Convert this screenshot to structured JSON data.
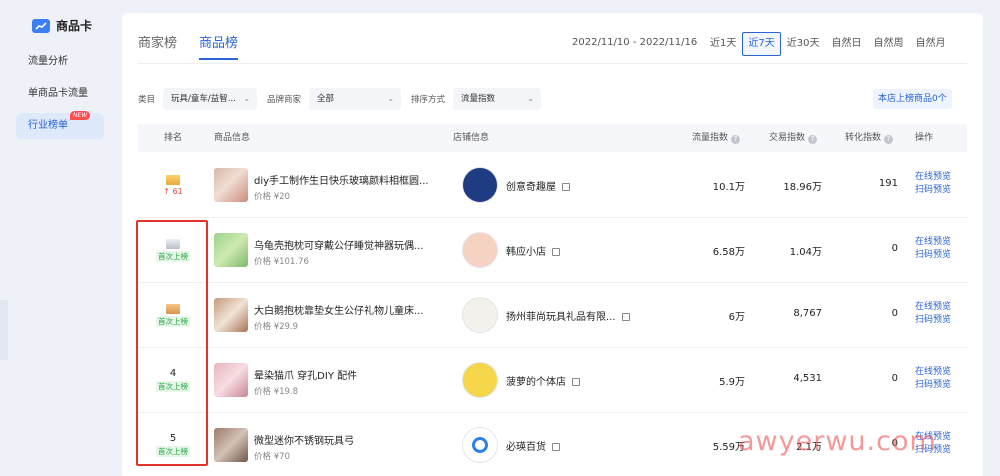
{
  "sidebar": {
    "brand": "商品卡",
    "items": [
      {
        "label": "流量分析"
      },
      {
        "label": "单商品卡流量"
      },
      {
        "label": "行业榜单",
        "badge": "NEW",
        "active": true
      }
    ]
  },
  "tabs": [
    {
      "label": "商家榜",
      "active": false
    },
    {
      "label": "商品榜",
      "active": true
    }
  ],
  "date_range": "2022/11/10 - 2022/11/16",
  "periods": [
    {
      "label": "近1天"
    },
    {
      "label": "近7天",
      "active": true
    },
    {
      "label": "近30天"
    },
    {
      "label": "自然日"
    },
    {
      "label": "自然周"
    },
    {
      "label": "自然月"
    }
  ],
  "filters": {
    "category_label": "类目",
    "category_value": "玩具/童车/益智...",
    "brand_label": "品牌商家",
    "brand_value": "全部",
    "sort_label": "排序方式",
    "sort_value": "流量指数"
  },
  "rank_count_button": "本店上榜商品0个",
  "table": {
    "headers": {
      "rank": "排名",
      "product": "商品信息",
      "shop": "店铺信息",
      "flow": "流量指数",
      "deal": "交易指数",
      "conversion": "转化指数",
      "action": "操作"
    },
    "rows": [
      {
        "crown": "gold",
        "rank": "",
        "change": "↑ 61",
        "badge": "",
        "name": "diy手工制作生日快乐玻璃颜料相框圆...",
        "price": "价格 ¥20",
        "shop": "创意奇趣屋",
        "flow": "10.1万",
        "deal": "18.96万",
        "conversion": "191"
      },
      {
        "crown": "silver",
        "rank": "",
        "change": "",
        "badge": "首次上榜",
        "name": "乌龟壳抱枕可穿戴公仔睡觉神器玩偶...",
        "price": "价格 ¥101.76",
        "shop": "韩应小店",
        "flow": "6.58万",
        "deal": "1.04万",
        "conversion": "0"
      },
      {
        "crown": "bronze",
        "rank": "",
        "change": "",
        "badge": "首次上榜",
        "name": "大白鹅抱枕靠垫女生公仔礼物儿童床...",
        "price": "价格 ¥29.9",
        "shop": "扬州菲尚玩具礼品有限...",
        "flow": "6万",
        "deal": "8,767",
        "conversion": "0"
      },
      {
        "crown": "",
        "rank": "4",
        "change": "",
        "badge": "首次上榜",
        "name": "晕染猫爪 穿孔DIY 配件",
        "price": "价格 ¥19.8",
        "shop": "菠萝的个体店",
        "flow": "5.9万",
        "deal": "4,531",
        "conversion": "0"
      },
      {
        "crown": "",
        "rank": "5",
        "change": "",
        "badge": "首次上榜",
        "name": "微型迷你不锈钢玩具弓",
        "price": "价格 ¥70",
        "shop": "必瑛百货",
        "flow": "5.59万",
        "deal": "2.1万",
        "conversion": "0"
      }
    ],
    "actions": {
      "preview_online": "在线预览",
      "preview_qr": "扫码预览"
    }
  },
  "watermark": "awyerwu.com"
}
